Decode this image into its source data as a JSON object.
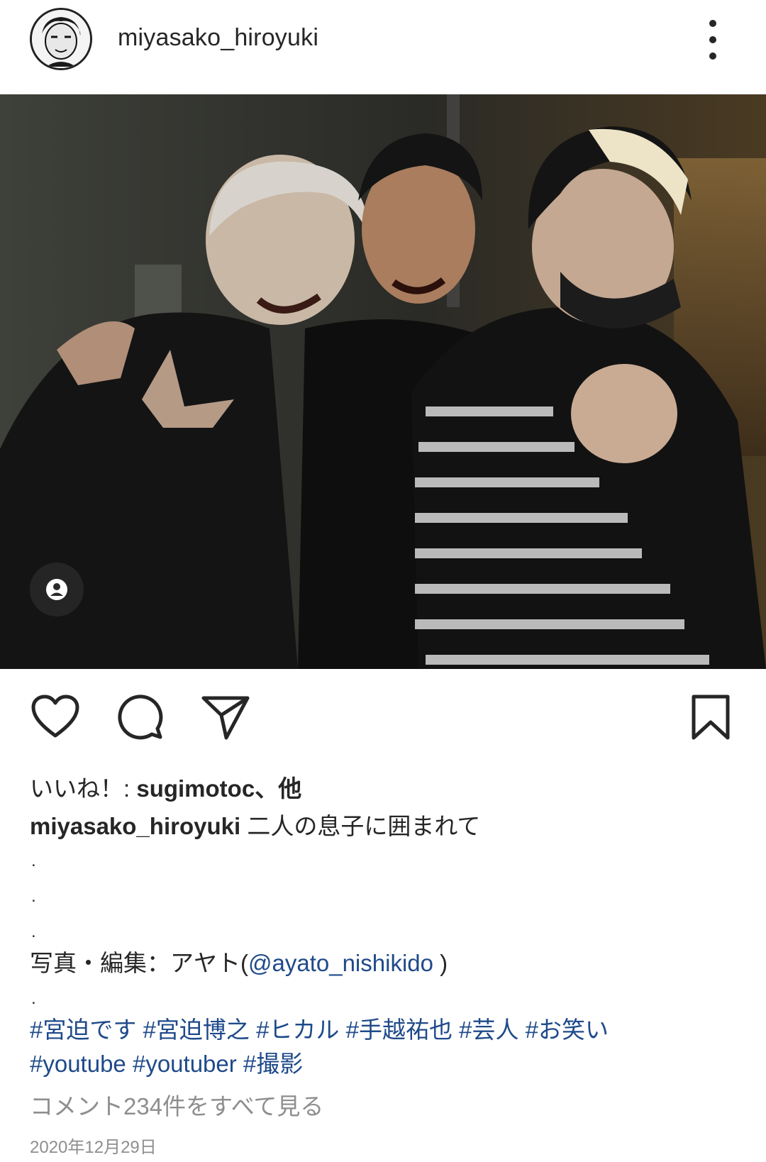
{
  "header": {
    "username": "miyasako_hiroyuki",
    "avatar_icon": "profile-avatar",
    "more_icon": "more-vertical-icon"
  },
  "photo": {
    "alt": "Photo post",
    "tag_icon": "user-tag-icon"
  },
  "actions": {
    "like_icon": "heart-icon",
    "comment_icon": "comment-icon",
    "share_icon": "send-icon",
    "save_icon": "bookmark-icon"
  },
  "likes": {
    "prefix": "いいね！: ",
    "user": "sugimotoc",
    "suffix": "、他"
  },
  "caption": {
    "author": "miyasako_hiroyuki",
    "text": " 二人の息子に囲まれて",
    "dots": [
      ".",
      ".",
      "."
    ],
    "credit_prefix": "写真・編集：アヤト(",
    "credit_mention": "@ayato_nishikido",
    "credit_suffix": " )",
    "dot4": ".",
    "hashtags_line1": [
      "#宮迫です",
      "#宮迫博之",
      "#ヒカル",
      "#手越祐也",
      "#芸人",
      "#お笑い"
    ],
    "hashtags_line2": [
      "#youtube",
      "#youtuber",
      "#撮影"
    ]
  },
  "comments_link": "コメント234件をすべて見る",
  "date": "2020年12月29日",
  "colors": {
    "link": "#1f4a8a",
    "text": "#262626",
    "muted": "#8e8e8e"
  }
}
